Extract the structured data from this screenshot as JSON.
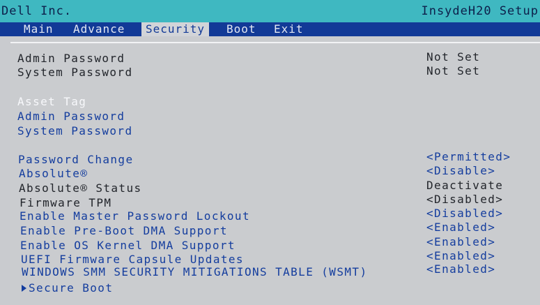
{
  "titlebar": {
    "vendor": "Dell Inc.",
    "product": "InsydeH20 Setup"
  },
  "menu": {
    "tabs": [
      "Main",
      "Advance",
      "Security",
      "Boot",
      "Exit"
    ],
    "active": "Security"
  },
  "info": [
    {
      "label": "Admin Password",
      "value": "Not Set"
    },
    {
      "label": "System Password",
      "value": "Not Set"
    }
  ],
  "actions": [
    "Asset Tag",
    "Admin Password",
    "System Password"
  ],
  "selected_action": "Asset Tag",
  "settings": [
    {
      "label": "Password Change",
      "value": "<Permitted>"
    },
    {
      "label": "Absolute®",
      "value": "<Disable>"
    },
    {
      "label": "Absolute® Status",
      "value": "Deactivate"
    },
    {
      "label": "Firmware TPM",
      "value": "<Disabled>"
    },
    {
      "label": "Enable Master Password Lockout",
      "value": "<Disabled>"
    },
    {
      "label": "Enable Pre-Boot DMA Support",
      "value": "<Enabled>"
    },
    {
      "label": "Enable OS Kernel DMA Support",
      "value": "<Enabled>"
    },
    {
      "label": "UEFI Firmware Capsule Updates",
      "value": "<Enabled>"
    },
    {
      "label": "WINDOWS SMM SECURITY MITIGATIONS TABLE (WSMT)",
      "value": "<Enabled>"
    }
  ],
  "submenu": {
    "label": "Secure Boot"
  }
}
